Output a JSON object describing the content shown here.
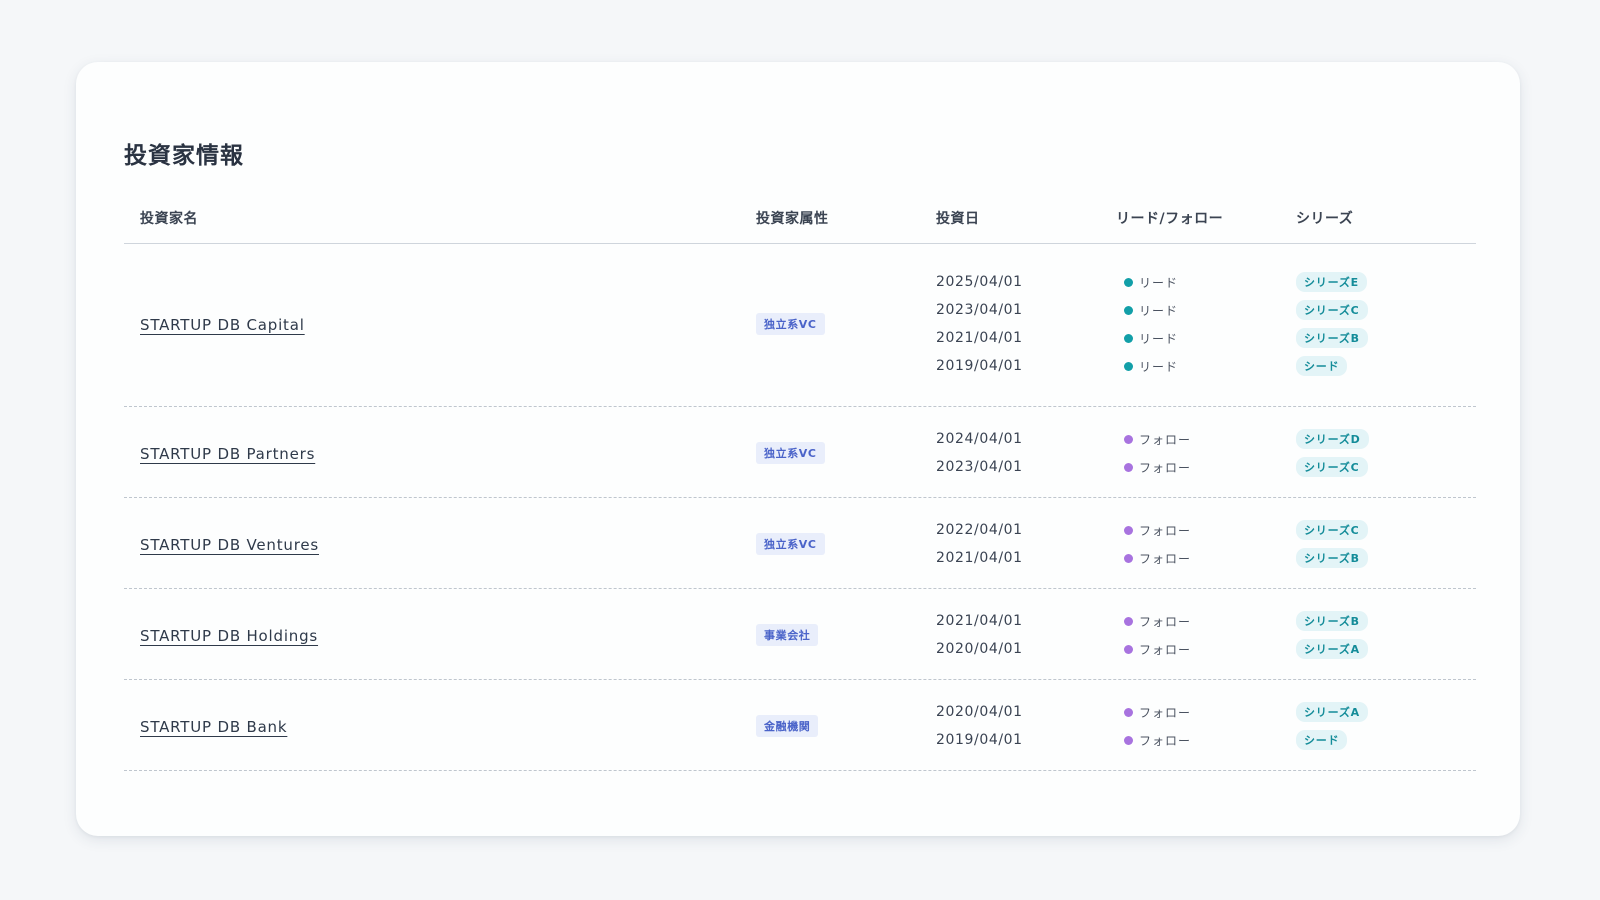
{
  "page": {
    "title": "投資家情報"
  },
  "table": {
    "headers": {
      "name": "投資家名",
      "attribute": "投資家属性",
      "date": "投資日",
      "lead_follow": "リード/フォロー",
      "series": "シリーズ"
    },
    "rows": [
      {
        "name": "STARTUP DB Capital",
        "attribute": "独立系VC",
        "investments": [
          {
            "date": "2025/04/01",
            "role": "リード",
            "role_type": "lead",
            "series": "シリーズE"
          },
          {
            "date": "2023/04/01",
            "role": "リード",
            "role_type": "lead",
            "series": "シリーズC"
          },
          {
            "date": "2021/04/01",
            "role": "リード",
            "role_type": "lead",
            "series": "シリーズB"
          },
          {
            "date": "2019/04/01",
            "role": "リード",
            "role_type": "lead",
            "series": "シード"
          }
        ]
      },
      {
        "name": "STARTUP DB Partners",
        "attribute": "独立系VC",
        "investments": [
          {
            "date": "2024/04/01",
            "role": "フォロー",
            "role_type": "follow",
            "series": "シリーズD"
          },
          {
            "date": "2023/04/01",
            "role": "フォロー",
            "role_type": "follow",
            "series": "シリーズC"
          }
        ]
      },
      {
        "name": "STARTUP DB Ventures",
        "attribute": "独立系VC",
        "investments": [
          {
            "date": "2022/04/01",
            "role": "フォロー",
            "role_type": "follow",
            "series": "シリーズC"
          },
          {
            "date": "2021/04/01",
            "role": "フォロー",
            "role_type": "follow",
            "series": "シリーズB"
          }
        ]
      },
      {
        "name": "STARTUP DB Holdings",
        "attribute": "事業会社",
        "investments": [
          {
            "date": "2021/04/01",
            "role": "フォロー",
            "role_type": "follow",
            "series": "シリーズB"
          },
          {
            "date": "2020/04/01",
            "role": "フォロー",
            "role_type": "follow",
            "series": "シリーズA"
          }
        ]
      },
      {
        "name": "STARTUP DB Bank",
        "attribute": "金融機関",
        "investments": [
          {
            "date": "2020/04/01",
            "role": "フォロー",
            "role_type": "follow",
            "series": "シリーズA"
          },
          {
            "date": "2019/04/01",
            "role": "フォロー",
            "role_type": "follow",
            "series": "シード"
          }
        ]
      }
    ]
  },
  "colors": {
    "lead_dot": "#129fa8",
    "follow_dot": "#a873df",
    "attribute_badge_bg": "#e9eefb",
    "attribute_badge_text": "#4a63c9",
    "series_badge_bg": "#e3f4f7",
    "series_badge_text": "#148c99"
  }
}
